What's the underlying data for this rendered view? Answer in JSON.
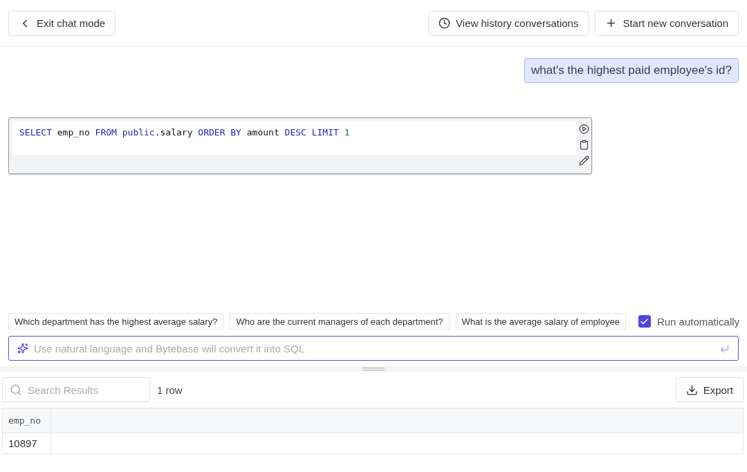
{
  "header": {
    "exit_button": "Exit chat mode",
    "history_button": "View history conversations",
    "new_button": "Start new conversation"
  },
  "messages": [
    {
      "kind": "user",
      "text": "what's the highest paid employee's id?"
    },
    {
      "kind": "sql",
      "tokens": [
        {
          "kind": "keyword",
          "text": "SELECT"
        },
        {
          "kind": "plain",
          "text": "emp_no"
        },
        {
          "kind": "keyword",
          "text": "FROM"
        },
        {
          "kind": "keyword",
          "text": "public"
        },
        {
          "kind": "plain",
          "text": ".salary"
        },
        {
          "kind": "keyword",
          "text": "ORDER BY"
        },
        {
          "kind": "plain",
          "text": "amount"
        },
        {
          "kind": "keyword",
          "text": "DESC LIMIT"
        },
        {
          "kind": "number",
          "text": "1"
        }
      ]
    }
  ],
  "suggestions": [
    "Which department has the highest average salary?",
    "Who are the current managers of each department?",
    "What is the average salary of employee"
  ],
  "run_automatically": {
    "label": "Run automatically",
    "checked": true
  },
  "prompt": {
    "placeholder": "Use natural language and Bytebase will convert it into SQL"
  },
  "results": {
    "search": {
      "placeholder": "Search Results"
    },
    "count": "1 row",
    "export_button": "Export",
    "table": {
      "columns": [
        "emp_no"
      ],
      "rows": [
        [
          "10897"
        ]
      ]
    }
  }
}
